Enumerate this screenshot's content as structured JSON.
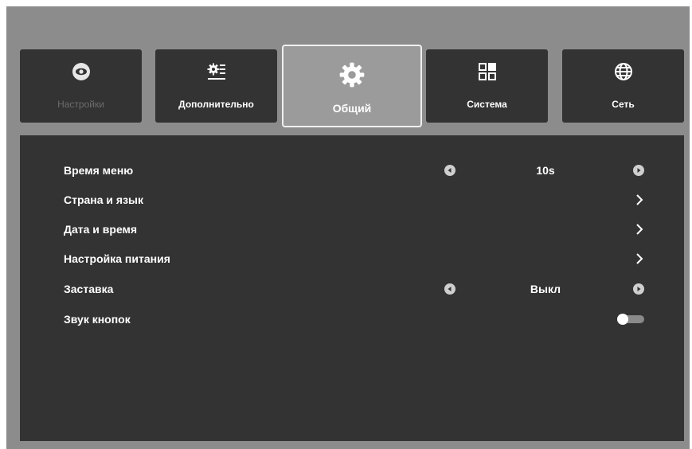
{
  "tabs": [
    {
      "label": "Настройки",
      "icon": "eye-icon",
      "state": "disabled"
    },
    {
      "label": "Дополнительно",
      "icon": "gear-list-icon",
      "state": "normal"
    },
    {
      "label": "Общий",
      "icon": "gear-icon",
      "state": "selected"
    },
    {
      "label": "Система",
      "icon": "grid-icon",
      "state": "normal"
    },
    {
      "label": "Сеть",
      "icon": "globe-icon",
      "state": "normal"
    }
  ],
  "settings": [
    {
      "label": "Время меню",
      "control": "selector",
      "value": "10s"
    },
    {
      "label": "Страна и язык",
      "control": "submenu"
    },
    {
      "label": "Дата и время",
      "control": "submenu"
    },
    {
      "label": "Настройка питания",
      "control": "submenu"
    },
    {
      "label": "Заставка",
      "control": "selector",
      "value": "Выкл"
    },
    {
      "label": "Звук кнопок",
      "control": "toggle",
      "toggle_on": false
    }
  ],
  "colors": {
    "screen_bg": "#8c8c8c",
    "panel_bg": "#333333",
    "tab_bg": "#333333",
    "tab_active_bg": "#9b9b9b",
    "text": "#ffffff",
    "text_dim": "#6c6c6c"
  }
}
